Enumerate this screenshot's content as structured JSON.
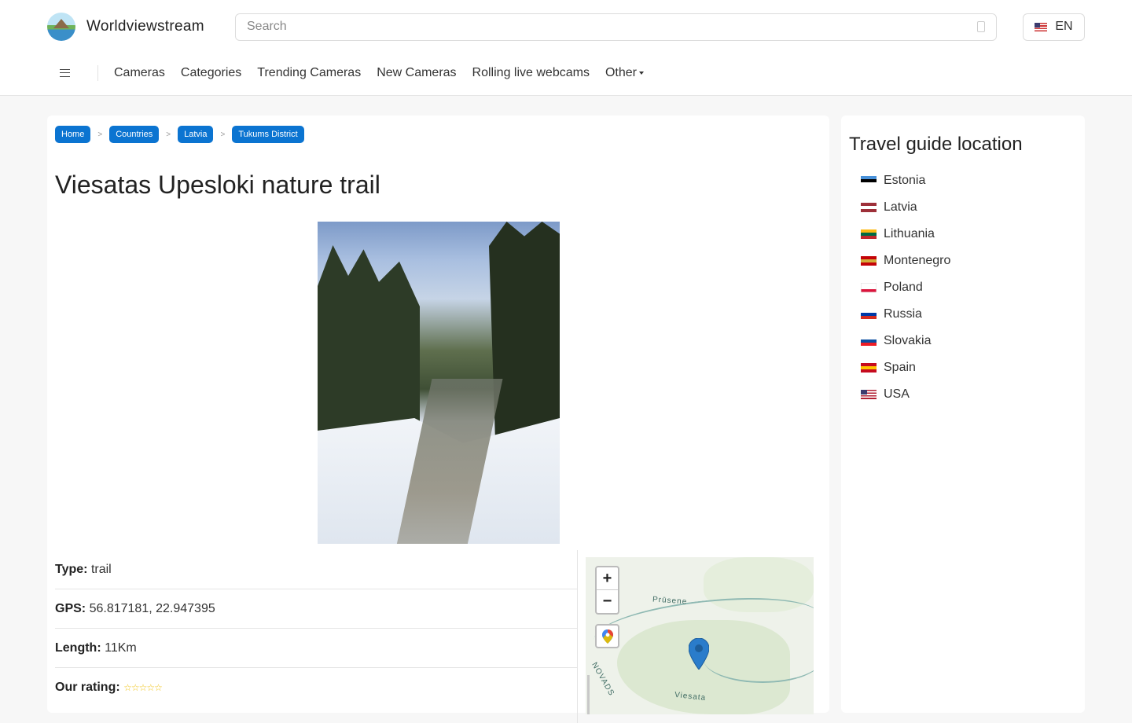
{
  "site": {
    "name": "Worldviewstream",
    "language": "EN"
  },
  "search": {
    "placeholder": "Search"
  },
  "nav": {
    "items": [
      "Cameras",
      "Categories",
      "Trending Cameras",
      "New Cameras",
      "Rolling live webcams",
      "Other"
    ]
  },
  "breadcrumb": [
    "Home",
    "Countries",
    "Latvia",
    "Tukums District"
  ],
  "breadcrumb_sep": ">",
  "page": {
    "title": "Viesatas Upesloki nature trail",
    "type_label": "Type:",
    "type_value": "trail",
    "gps_label": "GPS:",
    "gps_value": "56.817181, 22.947395",
    "length_label": "Length:",
    "length_value": "11Km",
    "rating_label": "Our rating:",
    "rating_stars": "☆☆☆☆☆"
  },
  "map": {
    "zoom_in": "+",
    "zoom_out": "−",
    "labels": {
      "river_top": "Prūsene",
      "river_bottom": "Viesata",
      "region": "NOVADS"
    }
  },
  "sidebar": {
    "title": "Travel guide location",
    "countries": [
      {
        "name": "Estonia",
        "colors": [
          "#4891d9",
          "#000000",
          "#ffffff"
        ]
      },
      {
        "name": "Latvia",
        "colors": [
          "#9e3039",
          "#ffffff",
          "#9e3039"
        ]
      },
      {
        "name": "Lithuania",
        "colors": [
          "#fdb913",
          "#006a44",
          "#c1272d"
        ]
      },
      {
        "name": "Montenegro",
        "colors": [
          "#c40308",
          "#d3ae3b",
          "#c40308"
        ]
      },
      {
        "name": "Poland",
        "colors": [
          "#ffffff",
          "#ffffff",
          "#dc143c"
        ]
      },
      {
        "name": "Russia",
        "colors": [
          "#ffffff",
          "#0039a6",
          "#d52b1e"
        ]
      },
      {
        "name": "Slovakia",
        "colors": [
          "#ffffff",
          "#0b4ea2",
          "#ee1c25"
        ]
      },
      {
        "name": "Spain",
        "colors": [
          "#c60b1e",
          "#ffc400",
          "#c60b1e"
        ]
      },
      {
        "name": "USA",
        "colors": [
          "#b22234",
          "#ffffff",
          "#b22234"
        ]
      }
    ]
  },
  "colors": {
    "accent": "#0b74d1",
    "star": "#f0c419"
  }
}
